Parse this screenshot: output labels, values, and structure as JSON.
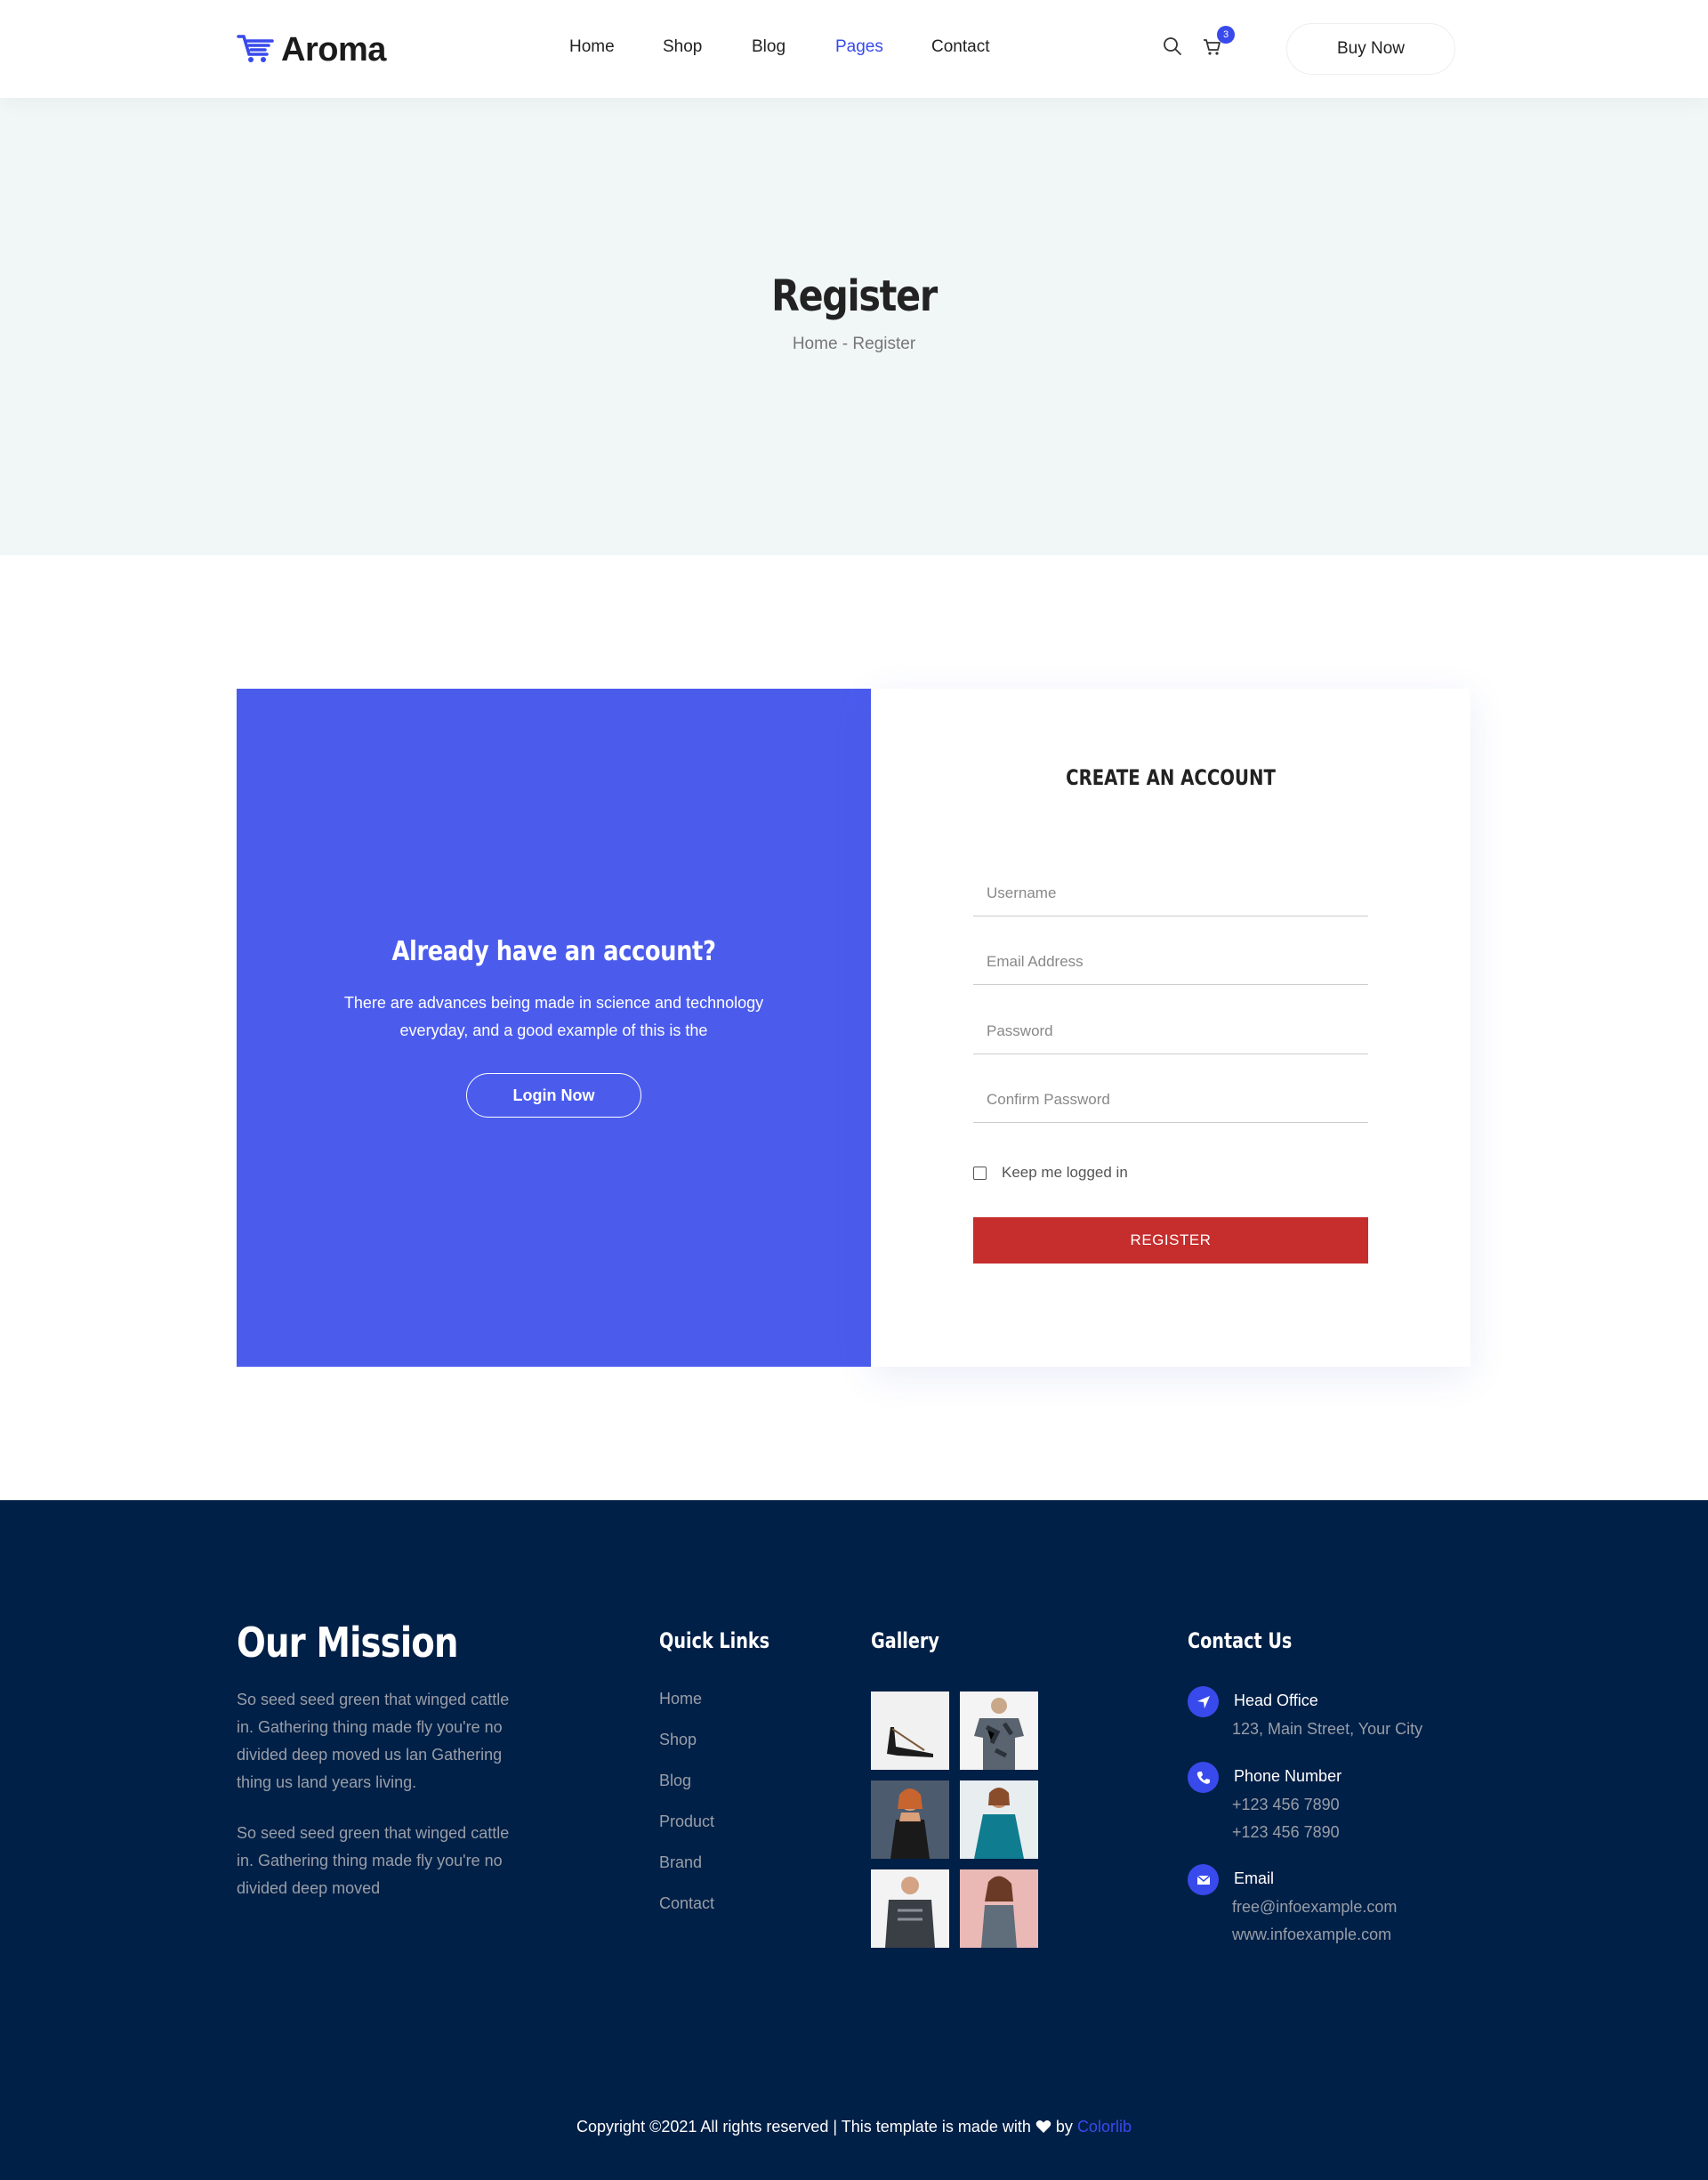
{
  "brand": {
    "name": "Aroma",
    "accent": "#384aeb",
    "panel_color": "#4b5ced",
    "register_color": "#c62d2d",
    "footer_bg": "#012047"
  },
  "nav": {
    "items": [
      "Home",
      "Shop",
      "Blog",
      "Pages",
      "Contact"
    ],
    "active": "Pages",
    "cart_count": "3",
    "buy_label": "Buy Now",
    "icons": [
      "search-icon",
      "cart-icon"
    ]
  },
  "banner": {
    "title": "Register",
    "breadcrumb_home": "Home",
    "breadcrumb_sep": " - ",
    "breadcrumb_current": "Register"
  },
  "login_panel": {
    "title": "Already have an account?",
    "text": "There are advances being made in science and technology everyday, and a good example of this is the",
    "button": "Login Now"
  },
  "register_form": {
    "title": "CREATE AN ACCOUNT",
    "fields": [
      {
        "placeholder": "Username",
        "value": ""
      },
      {
        "placeholder": "Email Address",
        "value": ""
      },
      {
        "placeholder": "Password",
        "value": ""
      },
      {
        "placeholder": "Confirm Password",
        "value": ""
      }
    ],
    "checkbox_label": "Keep me logged in",
    "checkbox_checked": false,
    "submit": "REGISTER"
  },
  "footer": {
    "mission_title": "Our Mission",
    "mission_p1": "So seed seed green that winged cattle in. Gathering thing made fly you're no divided deep moved us lan Gathering thing us land years living.",
    "mission_p2": "So seed seed green that winged cattle in. Gathering thing made fly you're no divided deep moved",
    "quick_links_title": "Quick Links",
    "quick_links": [
      "Home",
      "Shop",
      "Blog",
      "Product",
      "Brand",
      "Contact"
    ],
    "gallery_title": "Gallery",
    "gallery": [
      "high-heel-shoe",
      "camo-tshirt",
      "woman-black-dress",
      "woman-teal-dress",
      "man-sports-jersey",
      "woman-grey-top"
    ],
    "contact_title": "Contact Us",
    "head_office_label": "Head Office",
    "head_office": "123, Main Street, Your City",
    "phone_label": "Phone Number",
    "phone1": "+123 456 7890",
    "phone2": "+123 456 7890",
    "email_label": "Email",
    "email": "free@infoexample.com",
    "website": "www.infoexample.com",
    "copyright_text": "Copyright ©2021 All rights reserved | This template is made with",
    "copyright_by": "by",
    "copyright_link": "Colorlib"
  }
}
